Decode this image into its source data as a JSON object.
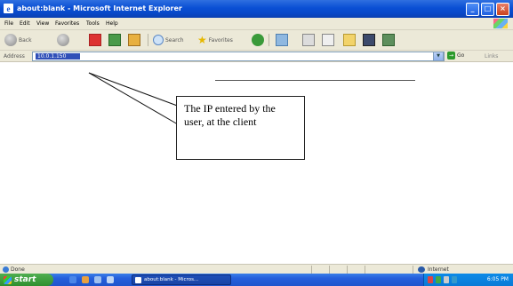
{
  "window": {
    "title": "about:blank - Microsoft Internet Explorer"
  },
  "menu": [
    "File",
    "Edit",
    "View",
    "Favorites",
    "Tools",
    "Help"
  ],
  "toolbar": {
    "back_label": "Back",
    "search_label": "Search",
    "favorites_label": "Favorites"
  },
  "address_bar": {
    "label": "Address",
    "value": "10.0.1.150",
    "go_label": "Go",
    "links_label": "Links"
  },
  "annotation": {
    "text": "The IP entered by the user, at the client"
  },
  "status_bar": {
    "status": "Done",
    "zone": "Internet"
  },
  "taskbar": {
    "start_label": "start",
    "task_label": "about:blank - Micros...",
    "clock": "6:05 PM"
  },
  "colors": {
    "titlebar": "#0a4fd4",
    "taskbar": "#245edb",
    "start": "#2f8f2f",
    "selection": "#2f4fb8"
  }
}
